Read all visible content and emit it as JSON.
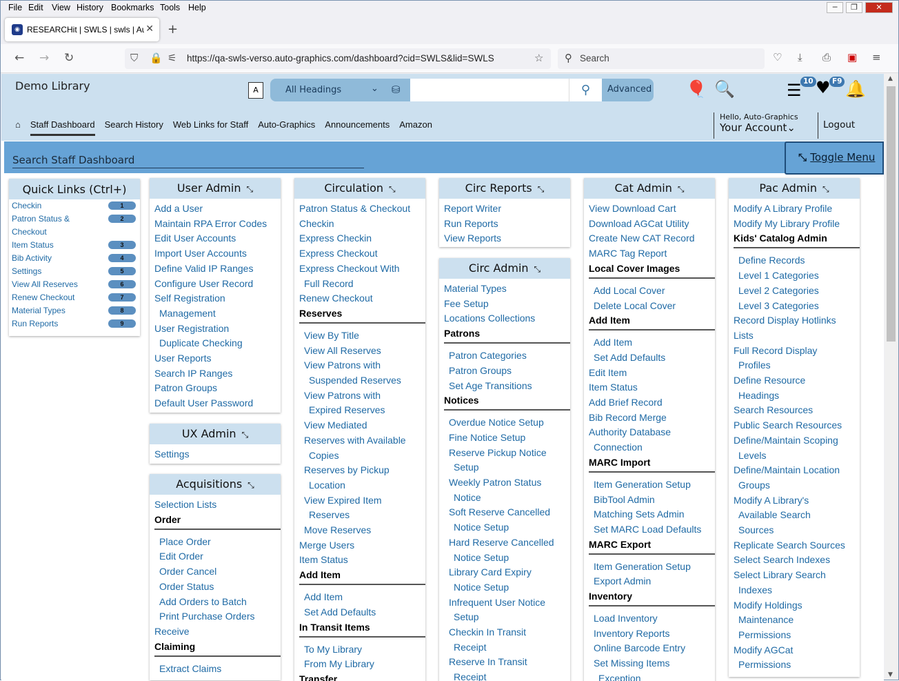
{
  "menubar": {
    "items": [
      "File",
      "Edit",
      "View",
      "History",
      "Bookmarks",
      "Tools",
      "Help"
    ]
  },
  "browser": {
    "tab_title": "RESEARCHit | SWLS | swls | Auto",
    "url": "https://qa-swls-verso.auto-graphics.com/dashboard?cid=SWLS&lid=SWLS",
    "search_placeholder": "Search"
  },
  "header": {
    "library": "Demo Library",
    "search_scope": "All Headings",
    "advanced": "Advanced",
    "list_count": "10",
    "fav_key": "F9",
    "greeting": "Hello, Auto-Graphics",
    "account": "Your Account",
    "logout": "Logout"
  },
  "nav": {
    "tabs": [
      "Staff Dashboard",
      "Search History",
      "Web Links for Staff",
      "Auto-Graphics",
      "Announcements",
      "Amazon"
    ]
  },
  "searchbar": {
    "placeholder": "Search Staff Dashboard",
    "toggle": "Toggle Menu"
  },
  "quick_links": {
    "title": "Quick Links (Ctrl+)",
    "items": [
      {
        "label": "Checkin",
        "key": "1"
      },
      {
        "label": "Patron Status & Checkout",
        "key": "2"
      },
      {
        "label": "Item Status",
        "key": "3"
      },
      {
        "label": "Bib Activity",
        "key": "4"
      },
      {
        "label": "Settings",
        "key": "5"
      },
      {
        "label": "View All Reserves",
        "key": "6"
      },
      {
        "label": "Renew Checkout",
        "key": "7"
      },
      {
        "label": "Material Types",
        "key": "8"
      },
      {
        "label": "Run Reports",
        "key": "9"
      }
    ]
  },
  "columns": [
    {
      "title": "User Admin",
      "items": [
        [
          "Add a User",
          ""
        ],
        [
          "Maintain RPA Error Codes",
          ""
        ],
        [
          "Edit User Accounts",
          ""
        ],
        [
          "Import User Accounts",
          ""
        ],
        [
          "Define Valid IP Ranges",
          ""
        ],
        [
          "Configure User Record",
          ""
        ],
        [
          "Self Registration",
          ""
        ],
        [
          "Management",
          "ind"
        ],
        [
          "User Registration",
          ""
        ],
        [
          "Duplicate Checking",
          "ind"
        ],
        [
          "User Reports",
          ""
        ],
        [
          "Search IP Ranges",
          ""
        ],
        [
          "Patron Groups",
          ""
        ],
        [
          "Default User Password",
          ""
        ]
      ]
    },
    {
      "title": "UX Admin",
      "items": [
        [
          "Settings",
          ""
        ]
      ]
    },
    {
      "title": "Acquisitions",
      "items": [
        [
          "Selection Lists",
          ""
        ],
        [
          "Order",
          "sub"
        ],
        [
          "Place Order",
          "ind"
        ],
        [
          "Edit Order",
          "ind"
        ],
        [
          "Order Cancel",
          "ind"
        ],
        [
          "Order Status",
          "ind"
        ],
        [
          "Add Orders to Batch",
          "ind"
        ],
        [
          "Print Purchase Orders",
          "ind"
        ],
        [
          "Receive",
          ""
        ],
        [
          "Claiming",
          "sub"
        ],
        [
          "Extract Claims",
          "ind"
        ]
      ]
    },
    {
      "title": "Circulation",
      "items": [
        [
          "Patron Status & Checkout",
          ""
        ],
        [
          "Checkin",
          ""
        ],
        [
          "Express Checkin",
          ""
        ],
        [
          "Express Checkout",
          ""
        ],
        [
          "Express Checkout With",
          ""
        ],
        [
          "Full Record",
          "ind"
        ],
        [
          "Renew Checkout",
          ""
        ],
        [
          "Reserves",
          "sub"
        ],
        [
          "View By Title",
          "ind"
        ],
        [
          "View All Reserves",
          "ind"
        ],
        [
          "View Patrons with",
          "ind"
        ],
        [
          "Suspended Reserves",
          "ind2"
        ],
        [
          "View Patrons with",
          "ind"
        ],
        [
          "Expired Reserves",
          "ind2"
        ],
        [
          "View Mediated",
          "ind"
        ],
        [
          "Reserves with Available",
          "ind"
        ],
        [
          "Copies",
          "ind2"
        ],
        [
          "Reserves by Pickup",
          "ind"
        ],
        [
          "Location",
          "ind2"
        ],
        [
          "View Expired Item",
          "ind"
        ],
        [
          "Reserves",
          "ind2"
        ],
        [
          "Move Reserves",
          "ind"
        ],
        [
          "Merge Users",
          ""
        ],
        [
          "Item Status",
          ""
        ],
        [
          "Add Item",
          "sub"
        ],
        [
          "Add Item",
          "ind"
        ],
        [
          "Set Add Defaults",
          "ind"
        ],
        [
          "In Transit Items",
          "sub"
        ],
        [
          "To My Library",
          "ind"
        ],
        [
          "From My Library",
          "ind"
        ],
        [
          "Transfer",
          "sub"
        ]
      ]
    },
    {
      "title": "Circ Reports",
      "items": [
        [
          "Report Writer",
          ""
        ],
        [
          "Run Reports",
          ""
        ],
        [
          "View Reports",
          ""
        ]
      ]
    },
    {
      "title": "Circ Admin",
      "items": [
        [
          "Material Types",
          ""
        ],
        [
          "Fee Setup",
          ""
        ],
        [
          "Locations Collections",
          ""
        ],
        [
          "Patrons",
          "sub"
        ],
        [
          "Patron Categories",
          "ind"
        ],
        [
          "Patron Groups",
          "ind"
        ],
        [
          "Set Age Transitions",
          "ind"
        ],
        [
          "Notices",
          "sub"
        ],
        [
          "Overdue Notice Setup",
          "ind"
        ],
        [
          "Fine Notice Setup",
          "ind"
        ],
        [
          "Reserve Pickup Notice",
          "ind"
        ],
        [
          "Setup",
          "ind2"
        ],
        [
          "Weekly Patron Status",
          "ind"
        ],
        [
          "Notice",
          "ind2"
        ],
        [
          "Soft Reserve Cancelled",
          "ind"
        ],
        [
          "Notice Setup",
          "ind2"
        ],
        [
          "Hard Reserve Cancelled",
          "ind"
        ],
        [
          "Notice Setup",
          "ind2"
        ],
        [
          "Library Card Expiry",
          "ind"
        ],
        [
          "Notice Setup",
          "ind2"
        ],
        [
          "Infrequent User Notice",
          "ind"
        ],
        [
          "Setup",
          "ind2"
        ],
        [
          "Checkin In Transit",
          "ind"
        ],
        [
          "Receipt",
          "ind2"
        ],
        [
          "Reserve In Transit",
          "ind"
        ],
        [
          "Receipt",
          "ind2"
        ]
      ]
    },
    {
      "title": "Cat Admin",
      "items": [
        [
          "View Download Cart",
          ""
        ],
        [
          "Download AGCat Utility",
          ""
        ],
        [
          "Create New CAT Record",
          ""
        ],
        [
          "MARC Tag Report",
          ""
        ],
        [
          "Local Cover Images",
          "sub"
        ],
        [
          "Add Local Cover",
          "ind"
        ],
        [
          "Delete Local Cover",
          "ind"
        ],
        [
          "Add Item",
          "sub"
        ],
        [
          "Add Item",
          "ind"
        ],
        [
          "Set Add Defaults",
          "ind"
        ],
        [
          "Edit Item",
          ""
        ],
        [
          "Item Status",
          ""
        ],
        [
          "Add Brief Record",
          ""
        ],
        [
          "Bib Record Merge",
          ""
        ],
        [
          "Authority Database",
          ""
        ],
        [
          "Connection",
          "ind"
        ],
        [
          "MARC Import",
          "sub"
        ],
        [
          "Item Generation Setup",
          "ind"
        ],
        [
          "BibTool Admin",
          "ind"
        ],
        [
          "Matching Sets Admin",
          "ind"
        ],
        [
          "Set MARC Load Defaults",
          "ind"
        ],
        [
          "MARC Export",
          "sub"
        ],
        [
          "Item Generation Setup",
          "ind"
        ],
        [
          "Export Admin",
          "ind"
        ],
        [
          "Inventory",
          "sub"
        ],
        [
          "Load Inventory",
          "ind"
        ],
        [
          "Inventory Reports",
          "ind"
        ],
        [
          "Online Barcode Entry",
          "ind"
        ],
        [
          "Set Missing Items",
          "ind"
        ],
        [
          "Exception",
          "ind2"
        ]
      ]
    },
    {
      "title": "Pac Admin",
      "items": [
        [
          "Modify A Library Profile",
          ""
        ],
        [
          "Modify My Library Profile",
          ""
        ],
        [
          "Kids' Catalog Admin",
          "sub"
        ],
        [
          "Define Records",
          "ind"
        ],
        [
          "Level 1 Categories",
          "ind"
        ],
        [
          "Level 2 Categories",
          "ind"
        ],
        [
          "Level 3 Categories",
          "ind"
        ],
        [
          "Record Display Hotlinks",
          ""
        ],
        [
          "Lists",
          ""
        ],
        [
          "Full Record Display",
          ""
        ],
        [
          "Profiles",
          "ind"
        ],
        [
          "Define Resource",
          ""
        ],
        [
          "Headings",
          "ind"
        ],
        [
          "Search Resources",
          ""
        ],
        [
          "Public Search Resources",
          ""
        ],
        [
          "Define/Maintain Scoping",
          ""
        ],
        [
          "Levels",
          "ind"
        ],
        [
          "Define/Maintain Location",
          ""
        ],
        [
          "Groups",
          "ind"
        ],
        [
          "Modify A Library's",
          ""
        ],
        [
          "Available Search",
          "ind"
        ],
        [
          "Sources",
          "ind"
        ],
        [
          "Replicate Search Sources",
          ""
        ],
        [
          "Select Search Indexes",
          ""
        ],
        [
          "Select Library Search",
          ""
        ],
        [
          "Indexes",
          "ind"
        ],
        [
          "Modify Holdings",
          ""
        ],
        [
          "Maintenance",
          "ind"
        ],
        [
          "Permissions",
          "ind"
        ],
        [
          "Modify AGCat",
          ""
        ],
        [
          "Permissions",
          "ind"
        ]
      ]
    }
  ]
}
